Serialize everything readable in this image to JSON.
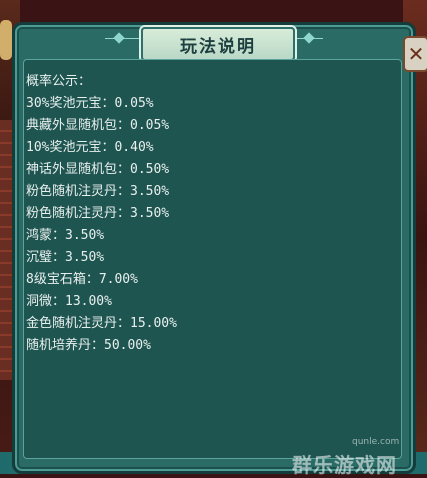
{
  "dialog": {
    "title": "玩法说明"
  },
  "content": {
    "lines": [
      "概率公示：",
      "30%奖池元宝：0.05%",
      "典藏外显随机包：0.05%",
      "10%奖池元宝：0.40%",
      "神话外显随机包：0.50%",
      "粉色随机注灵丹：3.50%",
      "粉色随机注灵丹：3.50%",
      "鸿蒙：3.50%",
      "沉璧：3.50%",
      "8级宝石箱：7.00%",
      "洞微：13.00%",
      "金色随机注灵丹：15.00%",
      "随机培养丹：50.00%"
    ]
  },
  "close": {
    "icon": "close-icon",
    "glyph": "✕"
  },
  "watermark": {
    "site": "qunle.com",
    "brand": "群乐游戏网"
  }
}
